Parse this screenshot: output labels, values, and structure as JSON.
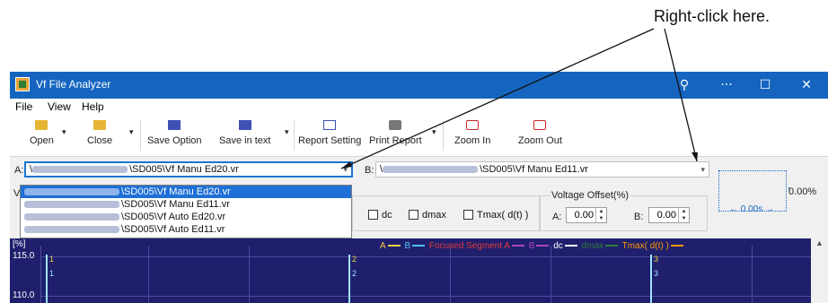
{
  "annotation": {
    "text": "Right-click here."
  },
  "window": {
    "title": "Vf File Analyzer",
    "controls": {
      "search": "⚲",
      "more": "···",
      "maximize": "☐",
      "close": "✕"
    }
  },
  "menu": [
    "File",
    "View",
    "Help"
  ],
  "toolbar": {
    "open": "Open",
    "close": "Close",
    "save_option": "Save Option",
    "save_text": "Save in text",
    "report_setting": "Report Setting",
    "print_report": "Print Report",
    "zoom_in": "Zoom In",
    "zoom_out": "Zoom Out"
  },
  "file_a": {
    "label": "A:",
    "value": "\\SD005\\Vf Manu Ed20.vr",
    "prefix": "\\"
  },
  "file_b": {
    "label": "B:",
    "value": "\\SD005\\Vf Manu Ed11.vr",
    "prefix": "\\"
  },
  "dropdown": [
    {
      "value": "\\SD005\\Vf Manu Ed20.vr",
      "selected": true
    },
    {
      "value": "\\SD005\\Vf Manu Ed11.vr",
      "selected": false
    },
    {
      "value": "\\SD005\\Vf Auto Ed20.vr",
      "selected": false
    },
    {
      "value": "\\SD005\\Vf Auto Ed11.vr",
      "selected": false
    }
  ],
  "checkboxes": {
    "dc": "dc",
    "dmax": "dmax",
    "tmax": "Tmax( d(t) )"
  },
  "voltage_offset": {
    "label": "Voltage Offset(%)",
    "a_label": "A:",
    "a_value": "0.00",
    "b_label": "B:",
    "b_value": "0.00"
  },
  "meter": {
    "percent": "0.00%",
    "time": "0.00s"
  },
  "plot": {
    "unit": "[%]",
    "y_ticks": [
      "115.0",
      "110.0"
    ],
    "legend": [
      {
        "name": "A",
        "color": "#f5d142"
      },
      {
        "name": "B",
        "color": "#4fc3f7"
      },
      {
        "name": "Focused Segment A",
        "color": "#e53935"
      },
      {
        "name": "B",
        "color": "#ab47bc"
      },
      {
        "name": "dc",
        "color": "#ffffff"
      },
      {
        "name": "dmax",
        "color": "#2e7d32"
      },
      {
        "name": "Tmax( d(t) )",
        "color": "#ff9800"
      }
    ],
    "markers": [
      "1",
      "1",
      "2",
      "2",
      "3",
      "3"
    ]
  },
  "partial_label": "V"
}
